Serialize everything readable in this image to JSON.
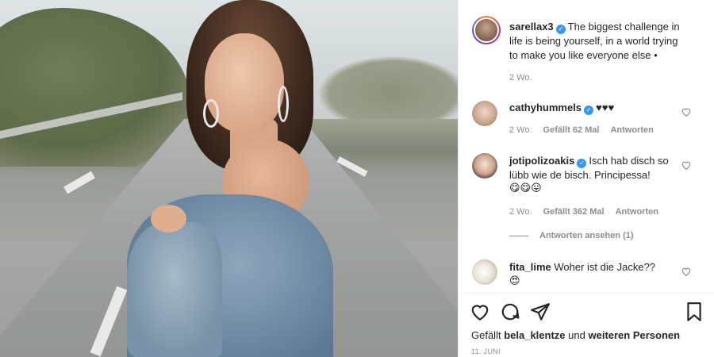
{
  "post": {
    "author": "sarellax3",
    "caption": "The biggest challenge in life is being yourself, in a world trying to make you like everyone else •",
    "caption_lines": [
      "The biggest challenge in",
      "life is being yourself, in a world trying",
      "to make you like everyone else •"
    ],
    "age": "2 Wo."
  },
  "comments": [
    {
      "user": "cathyhummels",
      "verified": true,
      "text": "♥♥♥",
      "age": "2 Wo.",
      "likes": "Gefällt 62 Mal",
      "reply": "Antworten"
    },
    {
      "user": "jotipolizoakis",
      "verified": true,
      "text_lines": [
        "Isch hab disch so",
        "lübb wie de bisch. Principessa!"
      ],
      "emojis": "😋😋😛",
      "age": "2 Wo.",
      "likes": "Gefällt 362 Mal",
      "reply": "Antworten",
      "view_replies": "Antworten ansehen (1)"
    },
    {
      "user": "fita_lime",
      "verified": false,
      "text": "Woher ist die Jacke??",
      "emojis": "😍"
    }
  ],
  "footer": {
    "likes_prefix": "Gefällt",
    "likes_user": "bela_klentze",
    "likes_mid": "und",
    "likes_suffix": "weiteren Personen",
    "date": "11. JUNI"
  },
  "icons": {
    "like": "heart-icon",
    "comment": "comment-icon",
    "share": "share-icon",
    "save": "bookmark-icon",
    "verified": "verified-badge-icon"
  },
  "colors": {
    "verified": "#3897f0",
    "text": "#262626",
    "muted": "#8e8e8e",
    "divider": "#efefef"
  }
}
